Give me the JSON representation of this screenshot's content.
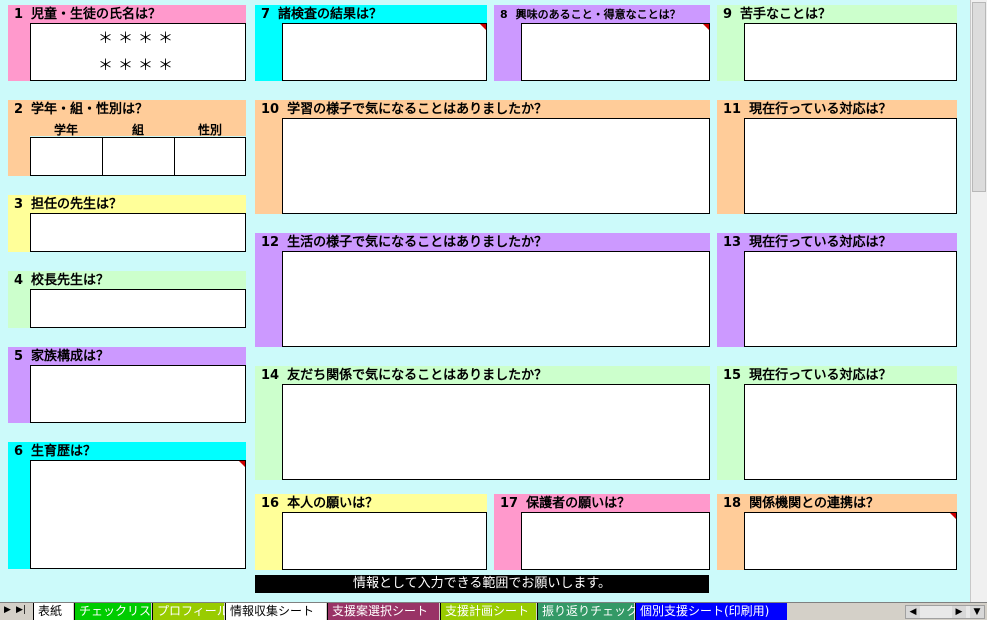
{
  "panels": {
    "p1": {
      "num": "1",
      "title": "児童・生徒の氏名は？",
      "rows": [
        "＊＊＊＊",
        "＊＊＊＊"
      ]
    },
    "p2": {
      "num": "2",
      "title": "学年・組・性別は？",
      "headers": [
        "学年",
        "組",
        "性別"
      ]
    },
    "p3": {
      "num": "3",
      "title": "担任の先生は？"
    },
    "p4": {
      "num": "4",
      "title": "校長先生は？"
    },
    "p5": {
      "num": "5",
      "title": "家族構成は？"
    },
    "p6": {
      "num": "6",
      "title": "生育歴は？"
    },
    "p7": {
      "num": "7",
      "title": "諸検査の結果は？"
    },
    "p8": {
      "num": "8",
      "title": "興味のあること・得意なことは？"
    },
    "p9": {
      "num": "9",
      "title": "苦手なことは？"
    },
    "p10": {
      "num": "10",
      "title": "学習の様子で気になることはありましたか？"
    },
    "p11": {
      "num": "11",
      "title": "現在行っている対応は？"
    },
    "p12": {
      "num": "12",
      "title": "生活の様子で気になることはありましたか？"
    },
    "p13": {
      "num": "13",
      "title": "現在行っている対応は？"
    },
    "p14": {
      "num": "14",
      "title": "友だち関係で気になることはありましたか？"
    },
    "p15": {
      "num": "15",
      "title": "現在行っている対応は？"
    },
    "p16": {
      "num": "16",
      "title": "本人の願いは？"
    },
    "p17": {
      "num": "17",
      "title": "保護者の願いは？"
    },
    "p18": {
      "num": "18",
      "title": "関係機関との連携は？"
    }
  },
  "message": "情報として入力できる範囲でお願いします。",
  "tabs": [
    {
      "label": "表紙",
      "color": "#ffffff",
      "text": "#000000"
    },
    {
      "label": "チェックリスト",
      "color": "#00cc00",
      "text": "#ffffff"
    },
    {
      "label": "プロフィール",
      "color": "#99cc00",
      "text": "#ffffff"
    },
    {
      "label": "情報収集シート",
      "color": "#ffffff",
      "text": "#000000"
    },
    {
      "label": "支援案選択シート",
      "color": "#993366",
      "text": "#ffffff"
    },
    {
      "label": "支援計画シート",
      "color": "#99cc00",
      "text": "#ffffff"
    },
    {
      "label": "振り返りチェック",
      "color": "#339966",
      "text": "#ffffff"
    },
    {
      "label": "個別支援シート(印刷用)",
      "color": "#0000ff",
      "text": "#ffffff"
    }
  ],
  "colors": {
    "background": "#ccfafa",
    "pink": "#ff99cc",
    "cyan": "#00ffff",
    "peach": "#ffcc99",
    "yellow": "#ffff99",
    "green": "#ccffcc",
    "lavender": "#cc99ff"
  }
}
